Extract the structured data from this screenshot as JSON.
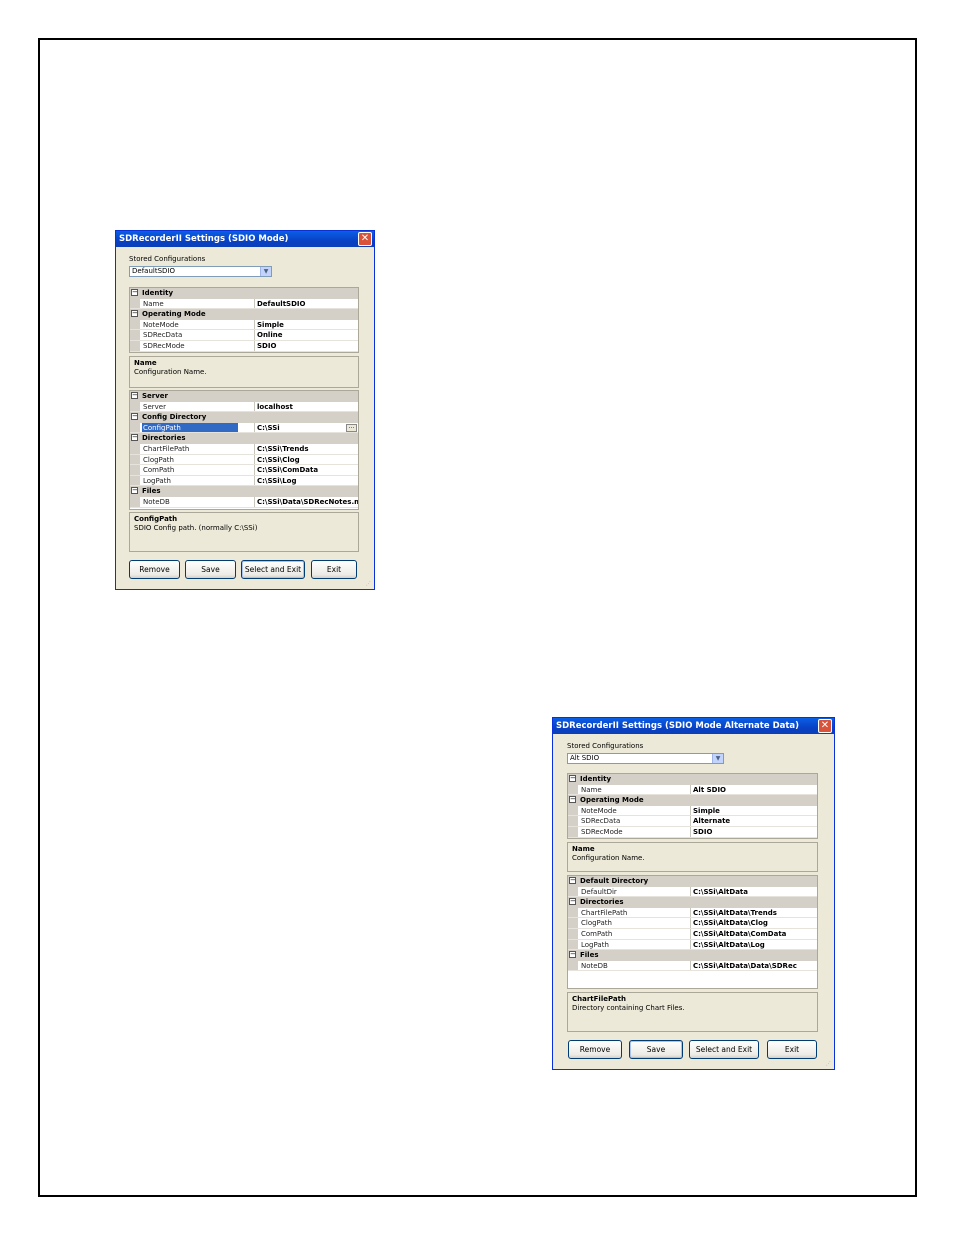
{
  "window1": {
    "title": "SDRecorderII Settings (SDIO Mode)",
    "close_glyph": "✕",
    "stored_label": "Stored Configurations",
    "stored_value": "DefaultSDIO",
    "grid1": [
      {
        "type": "cat",
        "label": "Identity"
      },
      {
        "type": "prop",
        "name": "Name",
        "value": "DefaultSDIO"
      },
      {
        "type": "cat",
        "label": "Operating Mode"
      },
      {
        "type": "prop",
        "name": "NoteMode",
        "value": "Simple"
      },
      {
        "type": "prop",
        "name": "SDRecData",
        "value": "Online"
      },
      {
        "type": "prop",
        "name": "SDRecMode",
        "value": "SDIO"
      }
    ],
    "desc1": {
      "title": "Name",
      "text": "Configuration Name."
    },
    "grid2": [
      {
        "type": "cat",
        "label": "Server"
      },
      {
        "type": "prop",
        "name": "Server",
        "value": "localhost"
      },
      {
        "type": "cat",
        "label": "Config Directory"
      },
      {
        "type": "prop",
        "name": "ConfigPath",
        "value": "C:\\SSi",
        "selected": true,
        "ellipsis": true
      },
      {
        "type": "cat",
        "label": "Directories"
      },
      {
        "type": "prop",
        "name": "ChartFilePath",
        "value": "C:\\SSi\\Trends"
      },
      {
        "type": "prop",
        "name": "ClogPath",
        "value": "C:\\SSi\\Clog"
      },
      {
        "type": "prop",
        "name": "ComPath",
        "value": "C:\\SSi\\ComData"
      },
      {
        "type": "prop",
        "name": "LogPath",
        "value": "C:\\SSi\\Log"
      },
      {
        "type": "cat",
        "label": "Files"
      },
      {
        "type": "prop",
        "name": "NoteDB",
        "value": "C:\\SSi\\Data\\SDRecNotes.m"
      }
    ],
    "desc2": {
      "title": "ConfigPath",
      "text": "SDIO Config path. (normally C:\\SSi)"
    },
    "buttons": {
      "remove": "Remove",
      "save": "Save",
      "select_exit": "Select and Exit",
      "exit": "Exit"
    }
  },
  "window2": {
    "title": "SDRecorderII Settings (SDIO Mode Alternate Data)",
    "close_glyph": "✕",
    "stored_label": "Stored Configurations",
    "stored_value": "Alt SDIO",
    "grid1": [
      {
        "type": "cat",
        "label": "Identity"
      },
      {
        "type": "prop",
        "name": "Name",
        "value": "Alt SDIO"
      },
      {
        "type": "cat",
        "label": "Operating Mode"
      },
      {
        "type": "prop",
        "name": "NoteMode",
        "value": "Simple"
      },
      {
        "type": "prop",
        "name": "SDRecData",
        "value": "Alternate"
      },
      {
        "type": "prop",
        "name": "SDRecMode",
        "value": "SDIO"
      }
    ],
    "desc1": {
      "title": "Name",
      "text": "Configuration Name."
    },
    "grid2": [
      {
        "type": "cat",
        "label": "Default Directory"
      },
      {
        "type": "prop",
        "name": "DefaultDir",
        "value": "C:\\SSi\\AltData"
      },
      {
        "type": "cat",
        "label": "Directories"
      },
      {
        "type": "prop",
        "name": "ChartFilePath",
        "value": "C:\\SSi\\AltData\\Trends"
      },
      {
        "type": "prop",
        "name": "ClogPath",
        "value": "C:\\SSi\\AltData\\Clog"
      },
      {
        "type": "prop",
        "name": "ComPath",
        "value": "C:\\SSi\\AltData\\ComData"
      },
      {
        "type": "prop",
        "name": "LogPath",
        "value": "C:\\SSi\\AltData\\Log"
      },
      {
        "type": "cat",
        "label": "Files"
      },
      {
        "type": "prop",
        "name": "NoteDB",
        "value": "C:\\SSi\\AltData\\Data\\SDRec"
      }
    ],
    "desc2": {
      "title": "ChartFilePath",
      "text": "Directory containing Chart Files."
    },
    "buttons": {
      "remove": "Remove",
      "save": "Save",
      "select_exit": "Select and Exit",
      "exit": "Exit"
    }
  },
  "icons": {
    "collapse": "⊟",
    "dropdown": "chevron-down-icon",
    "ellipsis": "..."
  }
}
